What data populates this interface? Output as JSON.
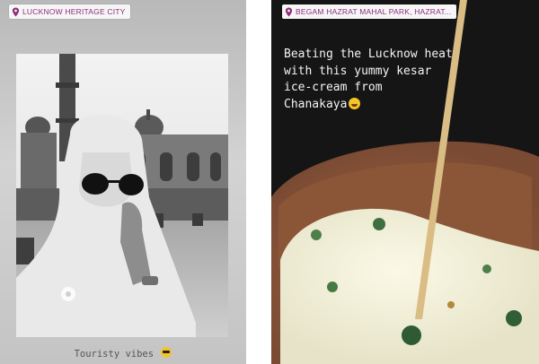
{
  "left_story": {
    "location": "LUCKNOW HERITAGE CITY",
    "caption": "Touristy vibes",
    "caption_emoji": "sunglasses-emoji"
  },
  "right_story": {
    "location": "BEGAM HAZRAT MAHAL PARK, HAZRAT...",
    "caption": "Beating the Lucknow heat\nwith this yummy kesar\nice-cream from\nChanakaya",
    "caption_emoji": "grinning-emoji"
  },
  "colors": {
    "location_text": "#8e2d7c",
    "location_bg": "#f6f6f6",
    "left_bg": "#c4c4c4",
    "right_bg": "#1c1c1c",
    "caption_light": "#f4f4f4",
    "caption_dark": "#555555"
  },
  "icons": [
    "location-pin-icon"
  ]
}
